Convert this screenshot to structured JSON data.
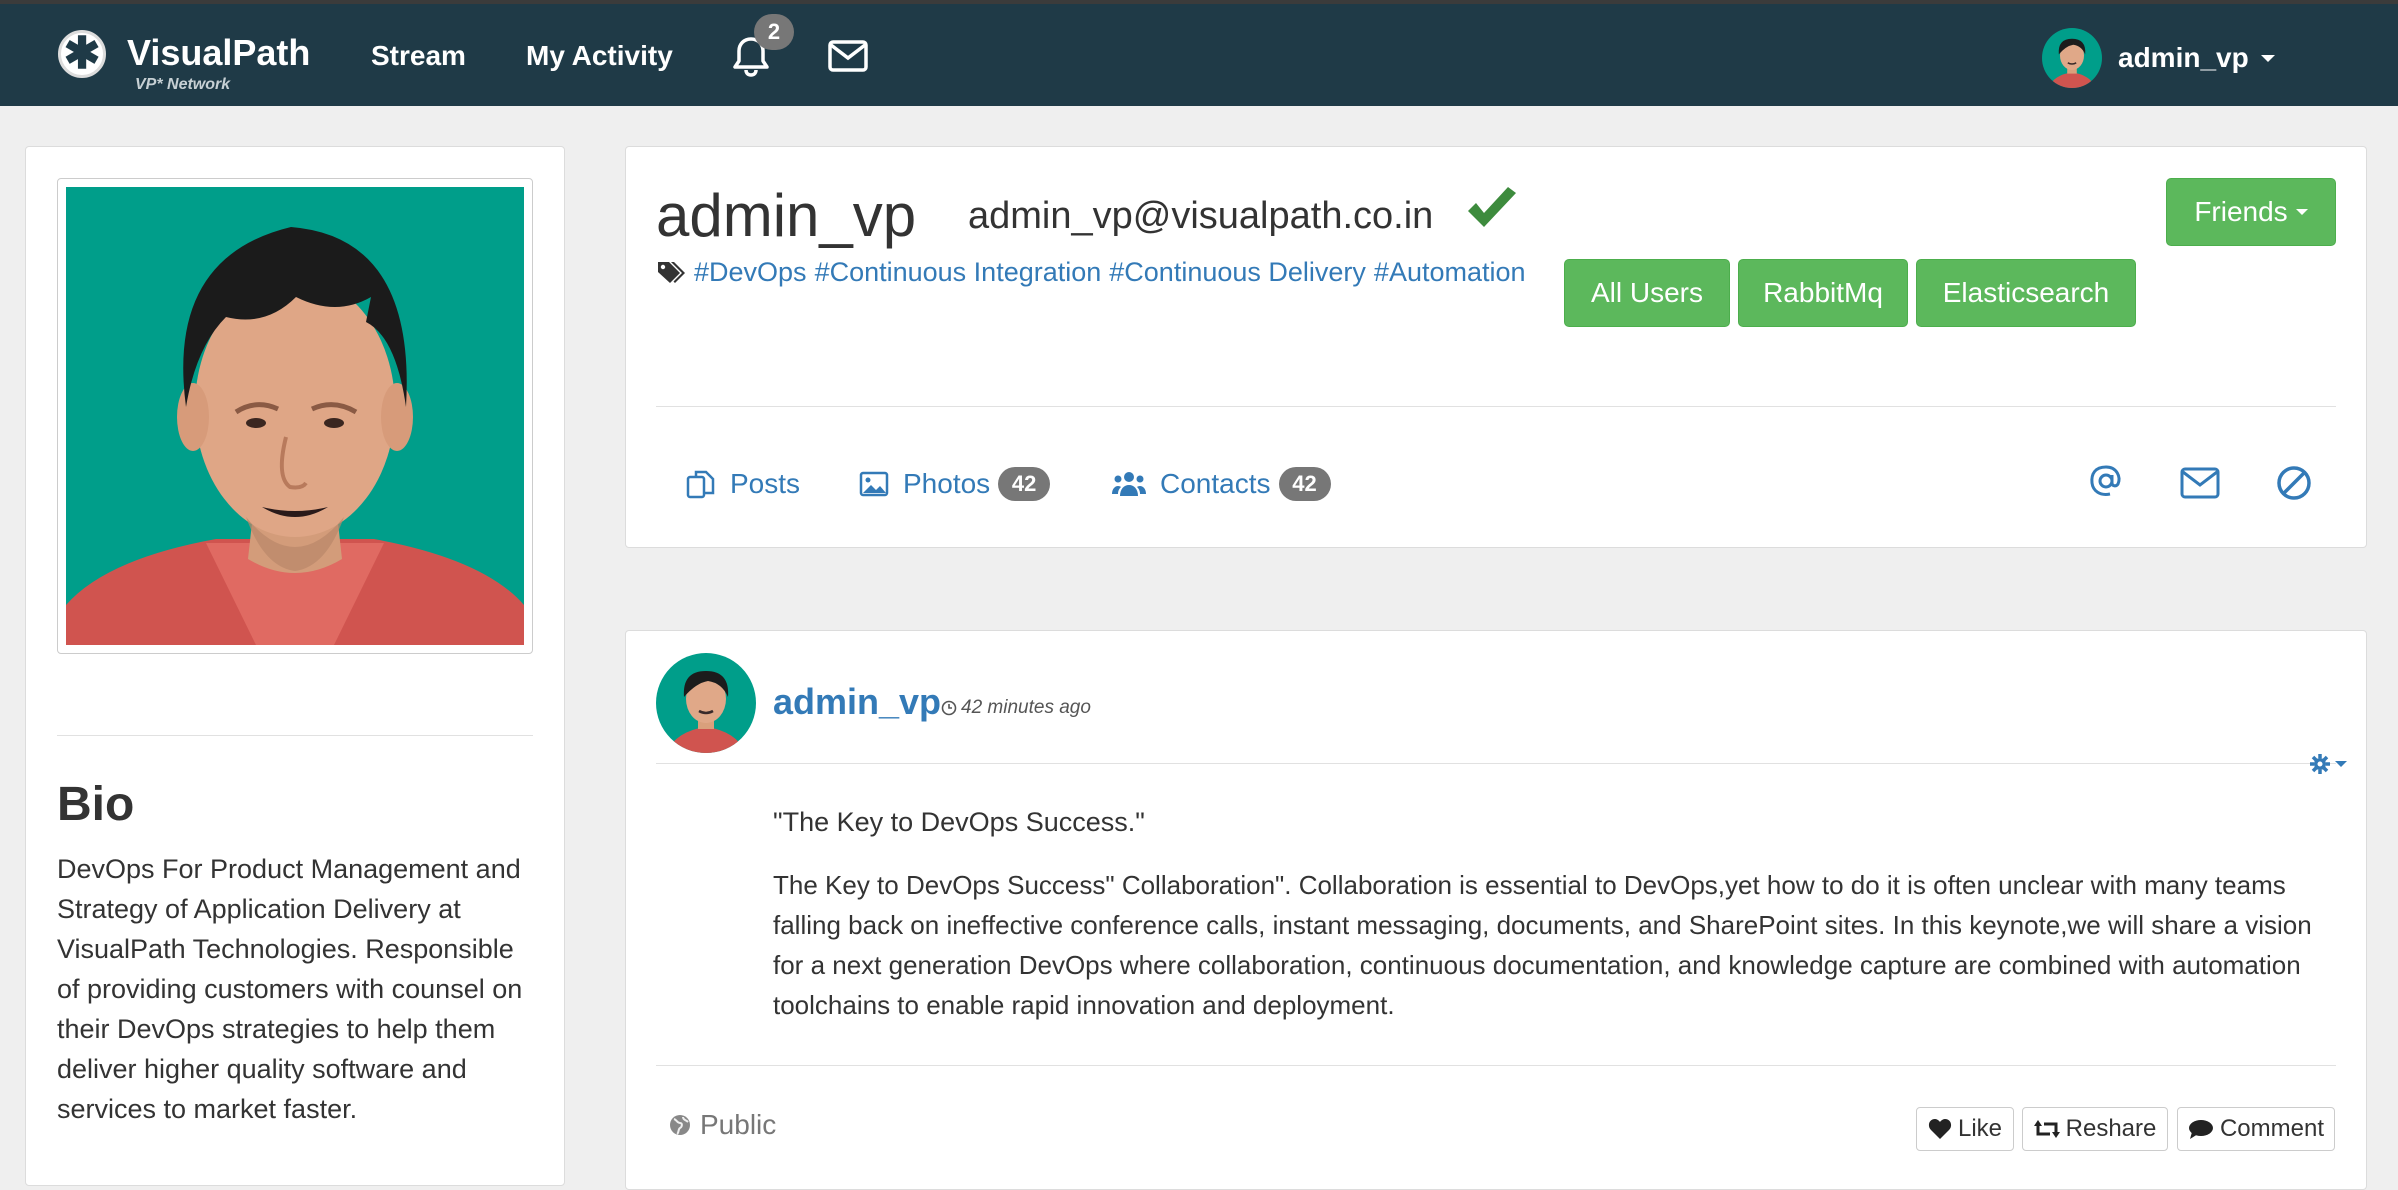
{
  "navbar": {
    "brand_name": "VisualPath",
    "brand_sub": "VP* Network",
    "links": [
      "Stream",
      "My Activity"
    ],
    "notification_count": "2",
    "user_name": "admin_vp"
  },
  "sidebar": {
    "bio_title": "Bio",
    "bio_text": "DevOps For Product Management and Strategy of Application Delivery at VisualPath Technologies. Responsible of providing customers with counsel on their DevOps strategies to help them deliver higher quality software and services to market faster."
  },
  "profile": {
    "name": "admin_vp",
    "email": "admin_vp@visualpath.co.in",
    "tags": [
      "#DevOps",
      "#Continuous Integration",
      "#Continuous Delivery",
      "#Automation"
    ],
    "groups": [
      "All Users",
      "RabbitMq",
      "Elasticsearch"
    ],
    "friends_label": "Friends",
    "tabs": [
      {
        "label": "Posts",
        "count": ""
      },
      {
        "label": "Photos",
        "count": "42"
      },
      {
        "label": "Contacts",
        "count": "42"
      }
    ]
  },
  "post": {
    "author": "admin_vp",
    "time": "42 minutes ago",
    "title": "\"The Key to DevOps Success.\"",
    "body": "The Key to DevOps Success\" Collaboration\". Collaboration is essential to DevOps,yet how to do it is often unclear with many teams falling back on ineffective conference calls, instant messaging, documents, and SharePoint sites. In this keynote,we will share a vision for a next generation DevOps where collaboration, continuous documentation, and knowledge capture are combined with automation toolchains to enable rapid innovation and deployment.",
    "visibility": "Public",
    "actions": [
      "Like",
      "Reshare",
      "Comment"
    ]
  },
  "colors": {
    "navbar_bg": "#1f3a47",
    "link": "#337ab7",
    "success": "#5cb85c",
    "badge": "#777777",
    "avatar_bg": "#009e8a"
  }
}
